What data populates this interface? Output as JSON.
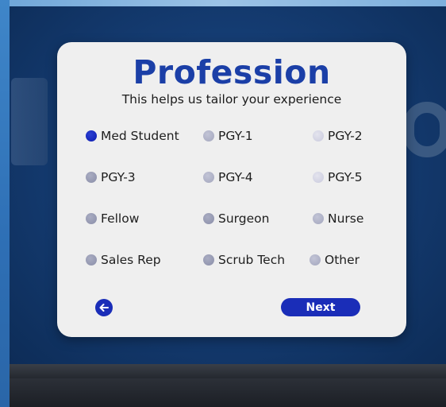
{
  "dialog": {
    "title": "Profession",
    "subtitle": "This helps us tailor your experience",
    "options": [
      {
        "label": "Med Student",
        "selected": true
      },
      {
        "label": "PGY-1",
        "selected": false
      },
      {
        "label": "PGY-2",
        "selected": false
      },
      {
        "label": "PGY-3",
        "selected": false
      },
      {
        "label": "PGY-4",
        "selected": false
      },
      {
        "label": "PGY-5",
        "selected": false
      },
      {
        "label": "Fellow",
        "selected": false
      },
      {
        "label": "Surgeon",
        "selected": false
      },
      {
        "label": "Nurse",
        "selected": false
      },
      {
        "label": "Sales Rep",
        "selected": false
      },
      {
        "label": "Scrub Tech",
        "selected": false
      },
      {
        "label": "Other",
        "selected": false
      }
    ],
    "next_label": "Next",
    "back_icon": "arrow-left-icon"
  },
  "colors": {
    "accent": "#1a2db8",
    "title": "#1b3fa7",
    "panel": "#efefef",
    "background": "#153d74"
  }
}
